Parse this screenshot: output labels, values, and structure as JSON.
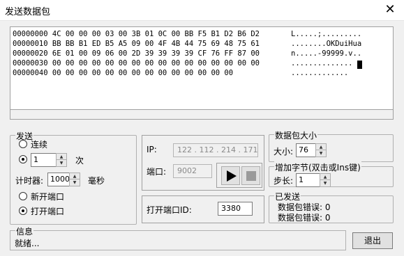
{
  "window": {
    "title": "发送数据包",
    "close_glyph": "✕"
  },
  "hex_view": {
    "lines": [
      "00000000 4C 00 00 00 03 00 3B 01 0C 00 BB F5 B1 D2 B6 D2",
      "00000010 BB BB B1 ED B5 A5 09 00 4F 4B 44 75 69 48 75 61",
      "00000020 6E 01 00 09 06 00 2D 39 39 39 39 CF 76 FF 87 00",
      "00000030 00 00 00 00 00 00 00 00 00 00 00 00 00 00 00 00",
      "00000040 00 00 00 00 00 00 00 00 00 00 00 00 00 00"
    ],
    "ascii": [
      "L.....;.........",
      "........OKDuiHua",
      "n.....-99999.v..",
      "..............",
      "............."
    ]
  },
  "send_group": {
    "label": "发送",
    "continuous_label": "连续",
    "count_value": "1",
    "count_unit": "次",
    "timer_label": "计时器:",
    "timer_value": "1000",
    "timer_unit": "毫秒",
    "new_port_label": "新开端口",
    "open_port_label": "打开端口"
  },
  "net_group": {
    "ip_label": "IP:",
    "ip_value": "122 . 112 . 214 . 171",
    "port_label": "端口:",
    "port_value": "9002"
  },
  "port_id": {
    "label": "打开端口ID:",
    "value": "3380"
  },
  "packet_size": {
    "label": "数据包大小",
    "size_label": "大小:",
    "size_value": "76"
  },
  "add_bytes": {
    "label": "增加字节(双击或Ins键)",
    "step_label": "步长:",
    "step_value": "1"
  },
  "sent": {
    "label": "已发送",
    "error1": "数据包错误: 0",
    "error2": "数据包错误: 0"
  },
  "info": {
    "label": "信息",
    "status": "就绪..."
  },
  "exit_label": "退出"
}
